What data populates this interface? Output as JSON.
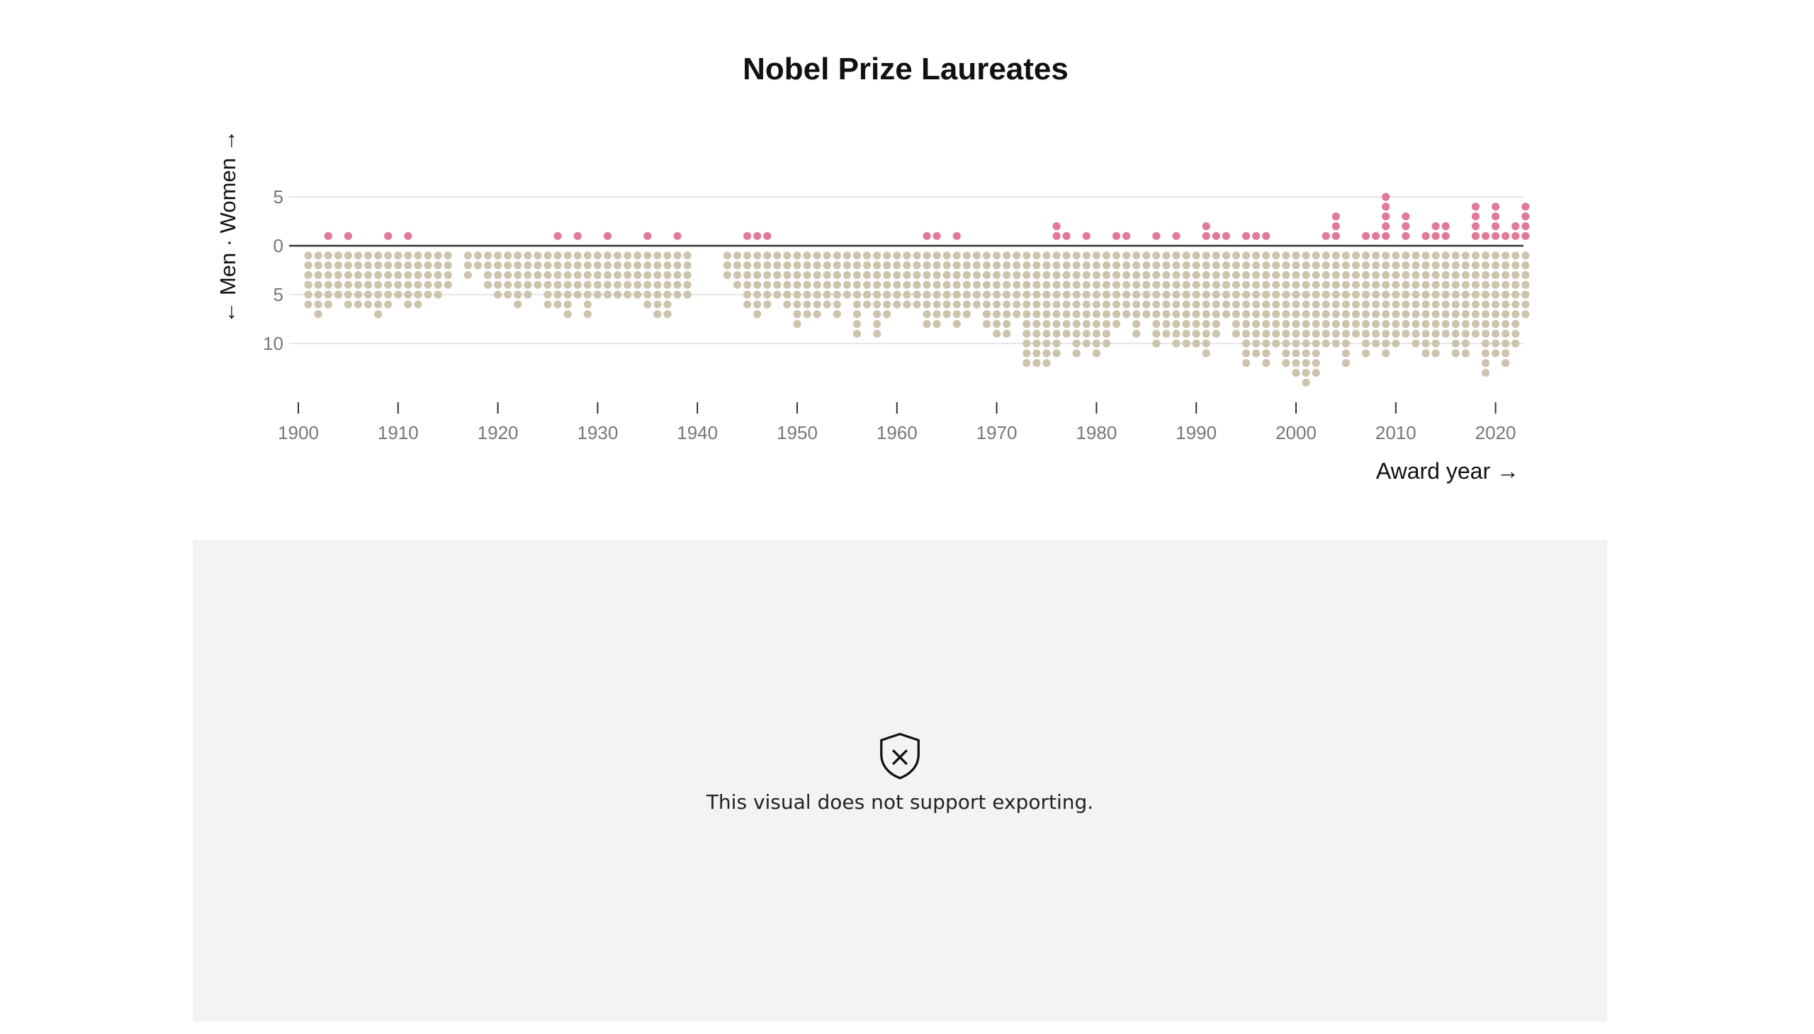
{
  "chart_data": {
    "type": "scatter",
    "title": "Nobel Prize Laureates",
    "xlabel": "Award year →",
    "ylabel": "← Men · Women →",
    "x_ticks": [
      "1900",
      "1910",
      "1920",
      "1930",
      "1940",
      "1950",
      "1960",
      "1970",
      "1980",
      "1990",
      "2000",
      "2010",
      "2020"
    ],
    "y_ticks": [
      "5",
      "0",
      "5",
      "10"
    ],
    "xlim": [
      1900,
      2023
    ],
    "ylim": [
      -14,
      5
    ],
    "grid": true,
    "series": [
      {
        "name": "Women",
        "color": "#e07a98",
        "years": [
          1903,
          1905,
          1909,
          1911,
          1926,
          1928,
          1931,
          1935,
          1938,
          1945,
          1946,
          1947,
          1963,
          1964,
          1966,
          1976,
          1977,
          1979,
          1982,
          1983,
          1986,
          1988,
          1991,
          1992,
          1993,
          1995,
          1996,
          1997,
          2003,
          2004,
          2007,
          2008,
          2009,
          2011,
          2013,
          2014,
          2015,
          2018,
          2019,
          2020,
          2021,
          2022,
          2023
        ],
        "counts": [
          1,
          1,
          1,
          1,
          1,
          1,
          1,
          1,
          1,
          1,
          1,
          1,
          1,
          1,
          1,
          2,
          1,
          1,
          1,
          1,
          1,
          1,
          2,
          1,
          1,
          1,
          1,
          1,
          1,
          3,
          1,
          1,
          5,
          3,
          1,
          2,
          2,
          4,
          1,
          4,
          1,
          2,
          4
        ]
      },
      {
        "name": "Men",
        "color": "#cdc4ad",
        "years": [
          1901,
          1902,
          1903,
          1904,
          1905,
          1906,
          1907,
          1908,
          1909,
          1910,
          1911,
          1912,
          1913,
          1914,
          1915,
          1917,
          1918,
          1919,
          1920,
          1921,
          1922,
          1923,
          1924,
          1925,
          1926,
          1927,
          1928,
          1929,
          1930,
          1931,
          1932,
          1933,
          1934,
          1935,
          1936,
          1937,
          1938,
          1939,
          1943,
          1944,
          1945,
          1946,
          1947,
          1948,
          1949,
          1950,
          1951,
          1952,
          1953,
          1954,
          1955,
          1956,
          1957,
          1958,
          1959,
          1960,
          1961,
          1962,
          1963,
          1964,
          1965,
          1966,
          1967,
          1968,
          1969,
          1970,
          1971,
          1972,
          1973,
          1974,
          1975,
          1976,
          1977,
          1978,
          1979,
          1980,
          1981,
          1982,
          1983,
          1984,
          1985,
          1986,
          1987,
          1988,
          1989,
          1990,
          1991,
          1992,
          1993,
          1994,
          1995,
          1996,
          1997,
          1998,
          1999,
          2000,
          2001,
          2002,
          2003,
          2004,
          2005,
          2006,
          2007,
          2008,
          2009,
          2010,
          2011,
          2012,
          2013,
          2014,
          2015,
          2016,
          2017,
          2018,
          2019,
          2020,
          2021,
          2022,
          2023
        ],
        "counts": [
          6,
          7,
          6,
          5,
          6,
          6,
          6,
          7,
          6,
          5,
          6,
          6,
          5,
          5,
          4,
          3,
          2,
          4,
          5,
          5,
          6,
          5,
          4,
          6,
          6,
          7,
          5,
          7,
          5,
          5,
          5,
          5,
          5,
          6,
          7,
          7,
          5,
          5,
          3,
          4,
          6,
          7,
          6,
          5,
          6,
          8,
          7,
          7,
          6,
          7,
          5,
          9,
          6,
          9,
          7,
          6,
          6,
          6,
          8,
          8,
          7,
          8,
          7,
          6,
          8,
          9,
          9,
          7,
          12,
          12,
          12,
          11,
          9,
          11,
          10,
          11,
          10,
          8,
          7,
          9,
          7,
          10,
          9,
          10,
          10,
          10,
          11,
          9,
          7,
          9,
          12,
          11,
          12,
          10,
          12,
          13,
          14,
          13,
          10,
          10,
          12,
          9,
          11,
          10,
          11,
          10,
          9,
          10,
          11,
          11,
          9,
          11,
          11,
          9,
          13,
          11,
          12,
          10,
          7
        ]
      }
    ]
  },
  "placeholder": {
    "icon": "shield-x-icon",
    "message": "This visual does not support exporting."
  }
}
